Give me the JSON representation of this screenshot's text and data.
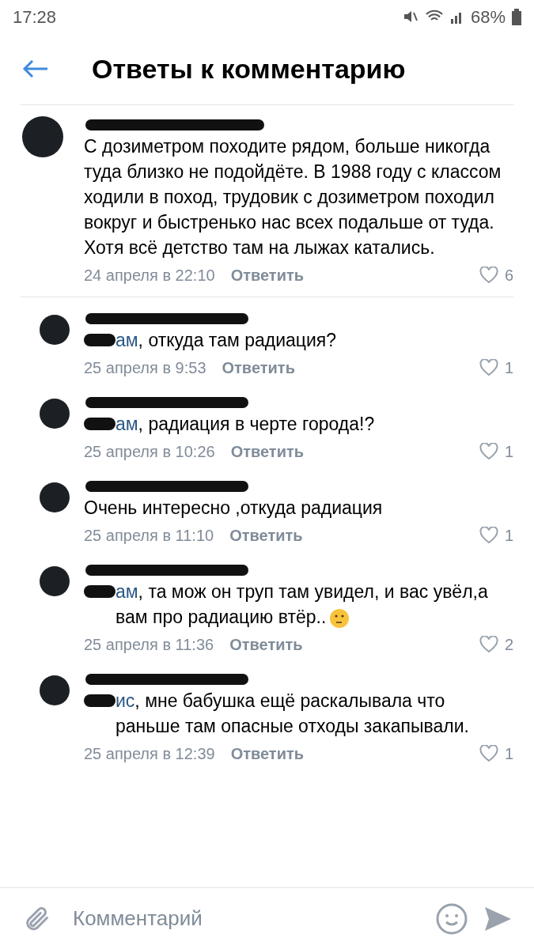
{
  "status_bar": {
    "time": "17:28",
    "battery": "68%"
  },
  "header": {
    "title": "Ответы к комментарию"
  },
  "comment": {
    "text": "С дозиметром походите рядом, больше никогда туда близко не подойдёте. В 1988 году с классом ходили в поход, трудовик с дозиметром походил вокруг и быстренько нас всех подальше от туда. Хотя всё детство там на лыжах катались.",
    "date": "24 апреля в 22:10",
    "reply": "Ответить",
    "likes": "6"
  },
  "replies": [
    {
      "mention": "ам",
      "text": ", откуда там радиация?",
      "date": "25 апреля в 9:53",
      "reply": "Ответить",
      "likes": "1"
    },
    {
      "mention": "ам",
      "text": ", радиация в черте города!?",
      "date": "25 апреля в 10:26",
      "reply": "Ответить",
      "likes": "1"
    },
    {
      "text": "Очень интересно ,откуда радиация",
      "date": "25 апреля в 11:10",
      "reply": "Ответить",
      "likes": "1"
    },
    {
      "mention": "ам",
      "text": ", та мож он труп там увидел, и вас увёл,а вам про радиацию втёр..",
      "emoji": true,
      "date": "25 апреля в 11:36",
      "reply": "Ответить",
      "likes": "2"
    },
    {
      "mention": "ис",
      "text": ", мне бабушка ещё раскалывала что раньше там опасные отходы закапывали.",
      "date": "25 апреля в 12:39",
      "reply": "Ответить",
      "likes": "1"
    }
  ],
  "composer": {
    "placeholder": "Комментарий"
  }
}
